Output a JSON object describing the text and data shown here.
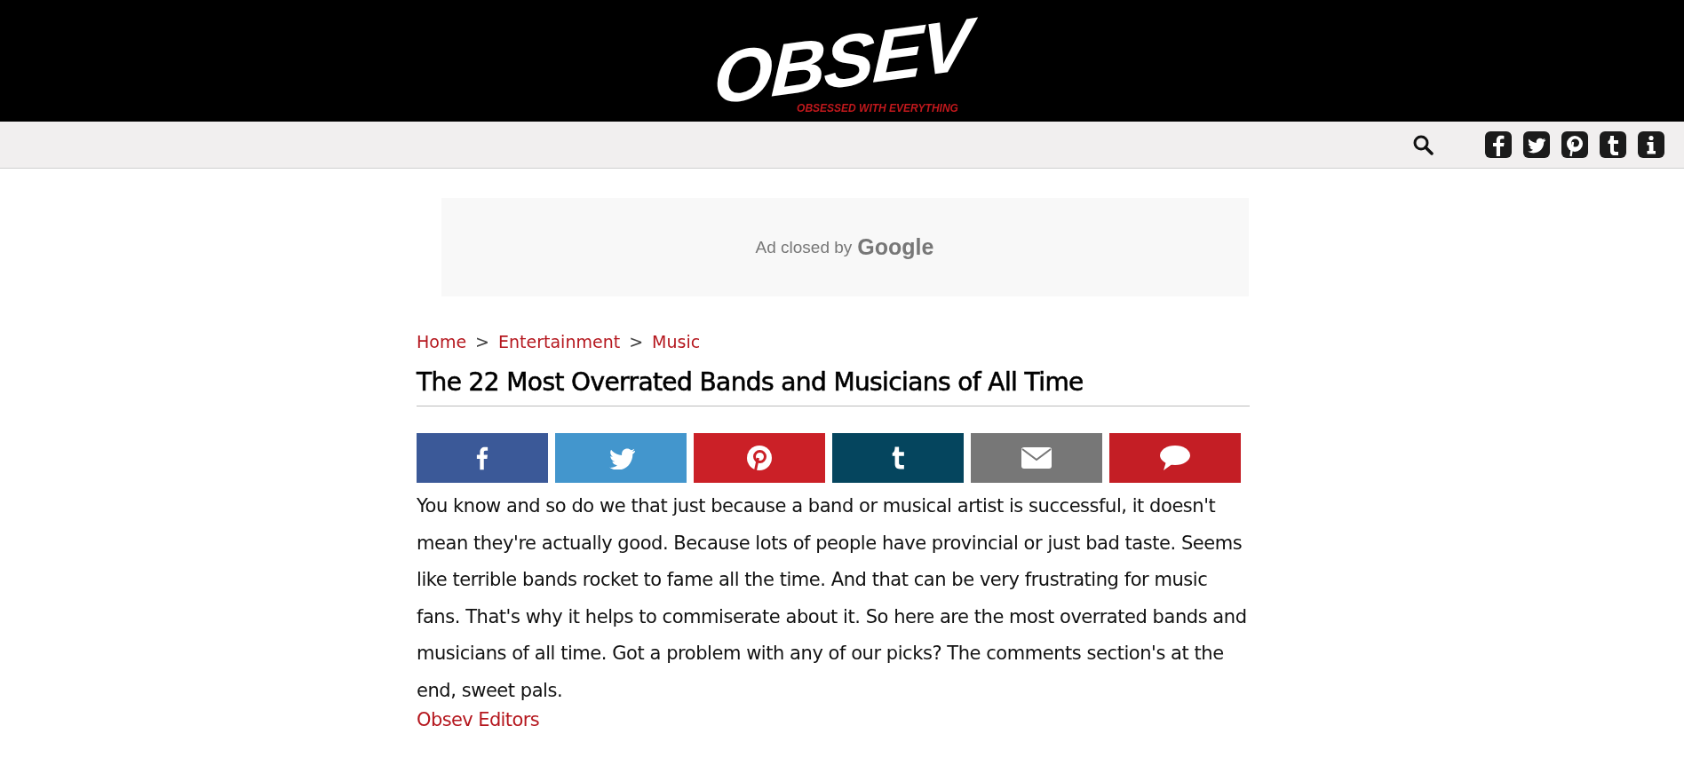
{
  "header": {
    "logo": "OBSEV",
    "tagline": "OBSESSED WITH EVERYTHING"
  },
  "toolbar": {
    "social": [
      {
        "kind": "facebook"
      },
      {
        "kind": "twitter"
      },
      {
        "kind": "pinterest"
      },
      {
        "kind": "tumblr"
      },
      {
        "kind": "info"
      }
    ]
  },
  "ad": {
    "text": "Ad closed by",
    "brand": "Google"
  },
  "breadcrumb": [
    {
      "label": "Home",
      "separator": ">"
    },
    {
      "label": "Entertainment",
      "separator": ">"
    },
    {
      "label": "Music"
    }
  ],
  "article": {
    "title": "The 22 Most Overrated Bands and Musicians of All Time",
    "share_buttons": [
      {
        "kind": "facebook",
        "color": "#3b5998"
      },
      {
        "kind": "twitter",
        "color": "#4396cd"
      },
      {
        "kind": "pinterest",
        "color": "#cb2027"
      },
      {
        "kind": "tumblr",
        "color": "#05455e"
      },
      {
        "kind": "email",
        "color": "#777777"
      },
      {
        "kind": "comment",
        "color": "#c41e25"
      }
    ],
    "body": "You know and so do we that just because a band or musical artist is successful, it doesn't mean they're actually good. Because lots of people have provincial or just bad taste. Seems like terrible bands rocket to fame all the time. And that can be very frustrating for music fans. That's why it helps to commiserate about it. So here are the most overrated bands and musicians of all time. Got a problem with any of our picks? The comments section's at the end, sweet pals.",
    "author": "Obsev Editors"
  }
}
